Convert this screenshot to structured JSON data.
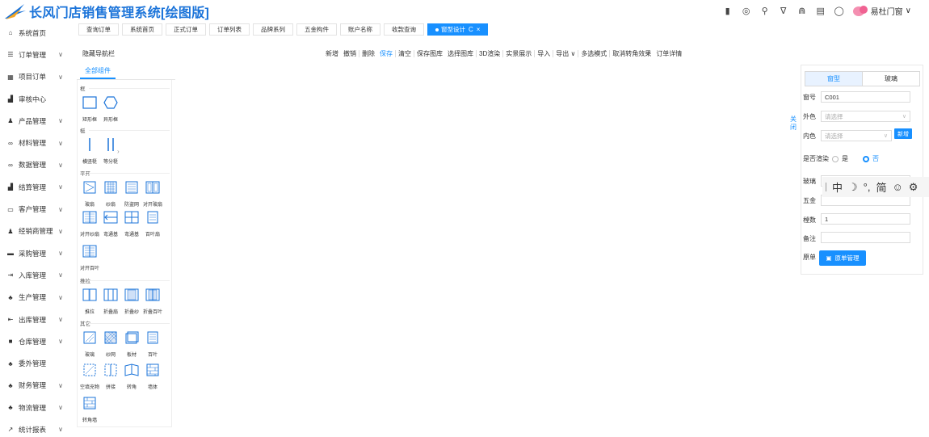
{
  "app": {
    "title": "长风门店销售管理系统[绘图版]",
    "user_name": "易杜门窗"
  },
  "header_icons": [
    "trash-icon",
    "target-icon",
    "search-icon",
    "shirt-icon",
    "bell-icon",
    "message-icon",
    "user-icon"
  ],
  "sidebar": {
    "items": [
      {
        "label": "系统首页",
        "icon": "home-icon",
        "chev": ""
      },
      {
        "label": "订单管理",
        "icon": "list-icon",
        "chev": "∨"
      },
      {
        "label": "项目订单",
        "icon": "grid-icon",
        "chev": "∨"
      },
      {
        "label": "审核中心",
        "icon": "chart-icon",
        "chev": ""
      },
      {
        "label": "产品管理",
        "icon": "users-icon",
        "chev": "∨"
      },
      {
        "label": "材料管理",
        "icon": "link-icon",
        "chev": "∨"
      },
      {
        "label": "数据管理",
        "icon": "link-icon",
        "chev": "∨"
      },
      {
        "label": "结算管理",
        "icon": "chart-icon",
        "chev": "∨"
      },
      {
        "label": "客户管理",
        "icon": "card-icon",
        "chev": "∨"
      },
      {
        "label": "经销商管理",
        "icon": "users-icon",
        "chev": "∨"
      },
      {
        "label": "采购管理",
        "icon": "truck-icon",
        "chev": "∨"
      },
      {
        "label": "入库管理",
        "icon": "login-icon",
        "chev": "∨"
      },
      {
        "label": "生产管理",
        "icon": "sitemap-icon",
        "chev": "∨"
      },
      {
        "label": "出库管理",
        "icon": "logout-icon",
        "chev": "∨"
      },
      {
        "label": "仓库管理",
        "icon": "box-icon",
        "chev": "∨"
      },
      {
        "label": "委外管理",
        "icon": "sitemap-icon",
        "chev": ""
      },
      {
        "label": "财务管理",
        "icon": "sitemap-icon",
        "chev": "∨"
      },
      {
        "label": "物流管理",
        "icon": "sitemap-icon",
        "chev": "∨"
      },
      {
        "label": "统计报表",
        "icon": "trend-icon",
        "chev": "∨"
      }
    ]
  },
  "tabs": [
    {
      "label": "查询订单"
    },
    {
      "label": "系统首页"
    },
    {
      "label": "正式订单"
    },
    {
      "label": "订单列表"
    },
    {
      "label": "品牌系列"
    },
    {
      "label": "五金构件"
    },
    {
      "label": "账户名称"
    },
    {
      "label": "收款查询"
    },
    {
      "label": "窗型设计",
      "active": true,
      "refresh": "C",
      "close": "×"
    }
  ],
  "toolbar": {
    "hide_nav": "隐藏导航栏",
    "items": [
      "新增",
      "撤销",
      "删除",
      "保存",
      "清空",
      "保存图库",
      "选择图库",
      "3D渲染",
      "实景展示",
      "导入",
      "导出 ∨",
      "多选模式",
      "取消转角效果",
      "订单详情"
    ]
  },
  "components": {
    "tab": "全部组件",
    "groups": {
      "frame": "框",
      "mullion": "梃",
      "casement": "平开",
      "sliding": "推拉",
      "other": "其它"
    },
    "items": {
      "rect_frame": "矩形框",
      "shape_frame": "异形框",
      "mullion": "横竖梃",
      "split_mullion": "等分梃",
      "glass_sash": "玻扇",
      "screen_sash": "纱扇",
      "theft_sash": "防盗网",
      "double_glass": "对开玻扇",
      "double_screen": "对开纱扇",
      "slide_bar": "弯通基",
      "slide_bar2": "弯通基",
      "louver_sash": "百叶扇",
      "double_louver": "对开百叶",
      "push_pull": "推拉",
      "fold_glass": "折叠扇",
      "fold_screen": "折叠纱",
      "fold_louver": "折叠百叶",
      "glass": "玻璃",
      "screen": "纱网",
      "panel": "板材",
      "louver": "百叶",
      "empty_fill": "空填充物",
      "joint": "拼接",
      "corner": "转角",
      "wall": "墙体",
      "corner_wall": "转角墙"
    }
  },
  "close_link": "关闭",
  "props": {
    "seg": [
      "窗型",
      "玻璃"
    ],
    "window_no_label": "窗号",
    "window_no": "C001",
    "outer_color_label": "外色",
    "outer_color_ph": "请选择",
    "inner_color_label": "内色",
    "inner_color_ph": "请选择",
    "add_btn": "新增",
    "render_label": "是否渲染",
    "yes": "是",
    "no": "否",
    "glass_label": "玻璃",
    "hardware_label": "五金",
    "count_label": "樘数",
    "count": "1",
    "remark_label": "备注",
    "bom_label": "原单",
    "bom_btn": "原单管理"
  },
  "ime": {
    "lang": "中",
    "moon": "☽",
    "punct": "°,",
    "simp": "简",
    "emoji": "☺",
    "gear": "⚙"
  }
}
